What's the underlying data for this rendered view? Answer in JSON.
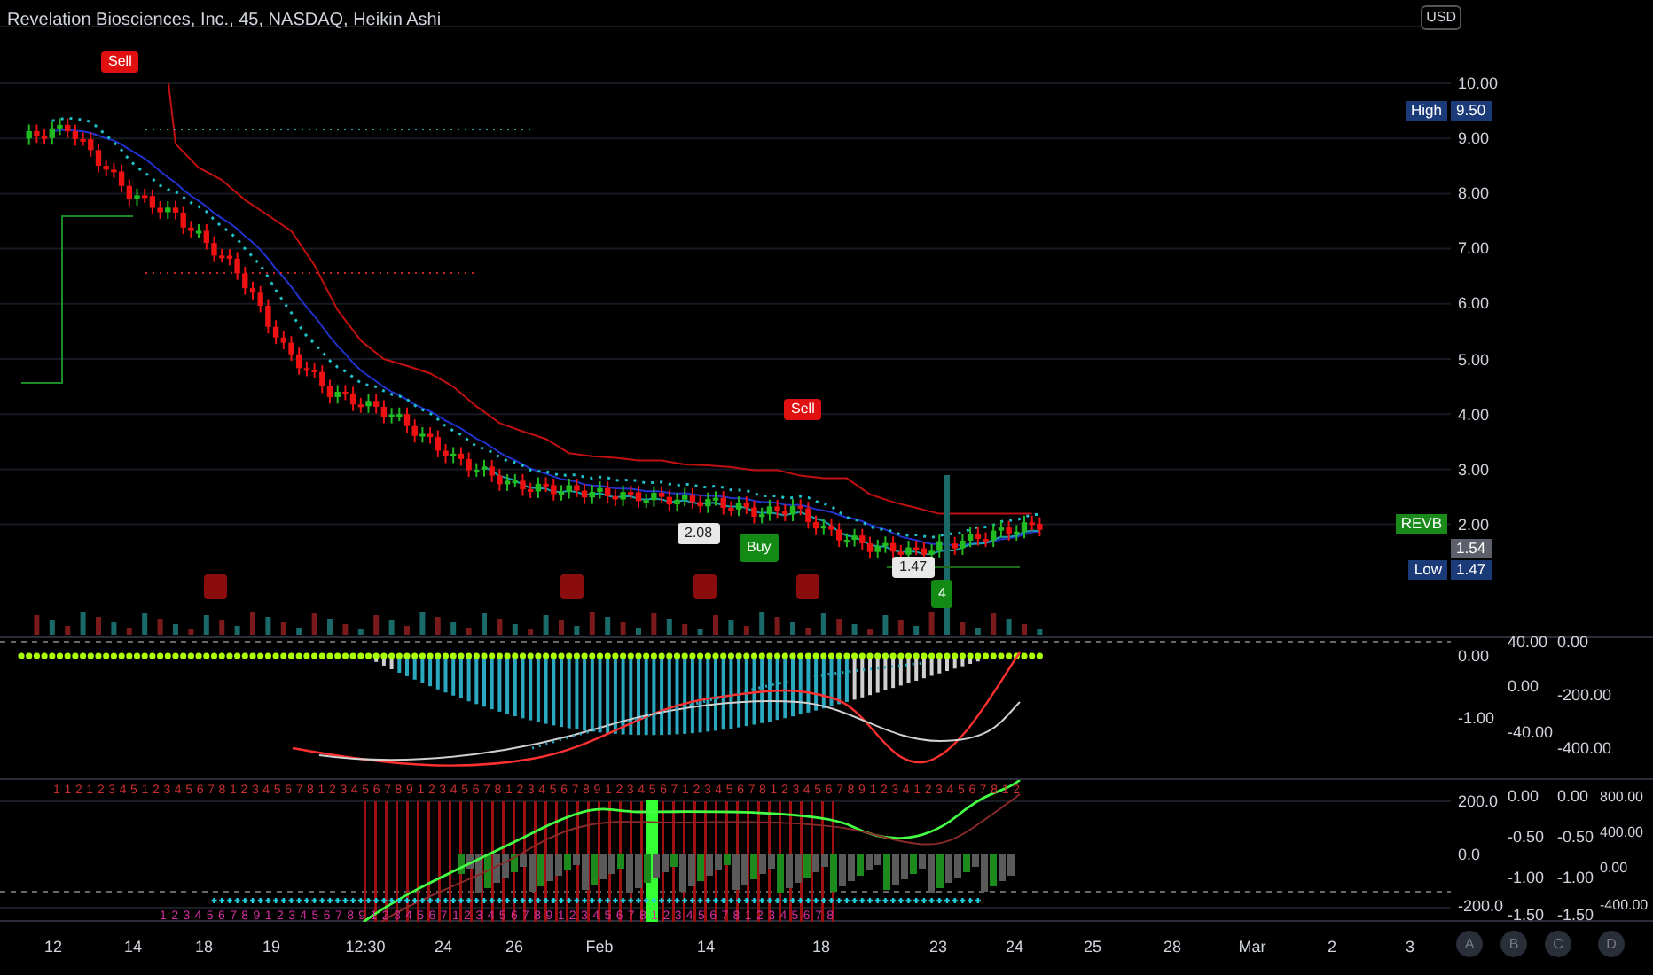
{
  "chart": {
    "title": "Revelation Biosciences, Inc., 45, NASDAQ, Heikin Ashi",
    "currency": "USD",
    "price_axis": [
      "10.00",
      "9.00",
      "8.00",
      "7.00",
      "6.00",
      "5.00",
      "4.00",
      "3.00",
      "2.00"
    ],
    "price_tags": [
      {
        "kind": "high",
        "label": "High",
        "value": "9.50"
      },
      {
        "kind": "symbol",
        "label": "REVB"
      },
      {
        "kind": "last",
        "value": "1.54"
      },
      {
        "kind": "low",
        "label": "Low",
        "value": "1.47"
      }
    ],
    "signals": [
      {
        "kind": "sell",
        "text": "Sell"
      },
      {
        "kind": "sell",
        "text": "Sell"
      },
      {
        "kind": "price",
        "text": "2.08"
      },
      {
        "kind": "buy",
        "text": "Buy"
      },
      {
        "kind": "price",
        "text": "1.47"
      },
      {
        "kind": "buy",
        "text": "4"
      }
    ]
  },
  "oscillator_pane": {
    "axes": [
      [
        "0.00",
        "-1.00"
      ],
      [
        "40.00",
        "0.00",
        "-40.00"
      ],
      [
        "0.00",
        "-200.00",
        "-400.00"
      ]
    ]
  },
  "lower_pane": {
    "axes": [
      [
        "200.0",
        "0.0",
        "-200.0"
      ],
      [
        "0.00",
        "-0.50",
        "-1.00",
        "-1.50"
      ],
      [
        "0.00",
        "-0.50",
        "-1.00",
        "-1.50"
      ],
      [
        "800.00",
        "400.00",
        "0.00",
        "-400.00"
      ]
    ],
    "count_rows": [
      "1 1 2 1 2 3 4 5 1 2 3 4 5 6 7 8 1 2 3 4 5 6 7 8 1 2 3 4 5 6 7 8 9 1 2 3 4 5 6 7 8 1 2 3 4 5 6 7 8 9 1 2 3 4 5 6 7 1 2 3 4 5 6 7 8 1 2 3 4 5 6 7 8 9 1 2 3 4 1 2 3 4 5 6 7 8 1 2",
      "1 2 3 4 5 6 7 8 9 1 2 3 4 5 6 7 8 9 1 2 3 4 5 6 7 1 2 3 4 5 6 7 8 9 1 2 3 4 5 6 7 8 1 2 3 4 5 6 7 8 1 2 3 4 5 6 7 8"
    ]
  },
  "time_axis": [
    "12",
    "14",
    "18",
    "19",
    "12:30",
    "24",
    "26",
    "Feb",
    "14",
    "18",
    "23",
    "24",
    "25",
    "28",
    "Mar",
    "2",
    "3"
  ],
  "scale_buttons": [
    "A",
    "B",
    "C",
    "D"
  ]
}
